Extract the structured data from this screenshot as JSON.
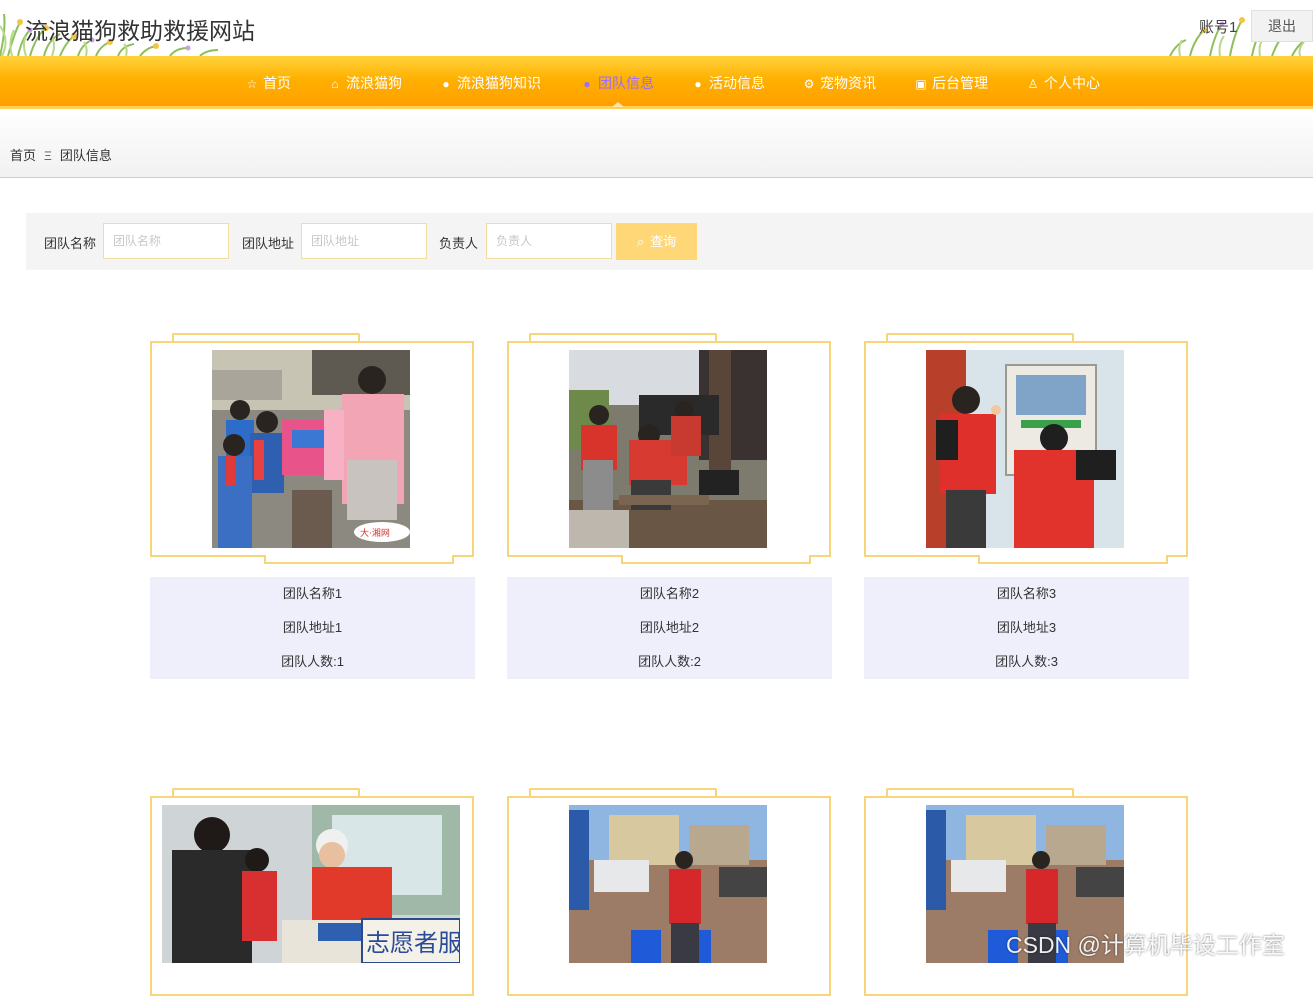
{
  "header": {
    "site_title": "流浪猫狗救助救援网站",
    "account_label": "账号1",
    "logout_label": "退出"
  },
  "nav": {
    "items": [
      {
        "icon": "star-icon",
        "label": "首页"
      },
      {
        "icon": "bag-icon",
        "label": "流浪猫狗"
      },
      {
        "icon": "info-icon",
        "label": "流浪猫狗知识"
      },
      {
        "icon": "help-icon",
        "label": "团队信息",
        "active": true
      },
      {
        "icon": "info-icon",
        "label": "活动信息"
      },
      {
        "icon": "settings-icon",
        "label": "宠物资讯"
      },
      {
        "icon": "gift-icon",
        "label": "后台管理"
      },
      {
        "icon": "user-icon",
        "label": "个人中心"
      }
    ],
    "active_color": "#9c6bff",
    "bar_color": "#ffb000"
  },
  "breadcrumb": {
    "home": "首页",
    "separator": "Ξ",
    "current": "团队信息"
  },
  "search": {
    "name_label": "团队名称",
    "name_placeholder": "团队名称",
    "address_label": "团队地址",
    "address_placeholder": "团队地址",
    "leader_label": "负责人",
    "leader_placeholder": "负责人",
    "button_label": "查询"
  },
  "cards": [
    {
      "name": "团队名称1",
      "address": "团队地址1",
      "count": "团队人数:1",
      "photo": "children-receiving-gifts-photo"
    },
    {
      "name": "团队名称2",
      "address": "团队地址2",
      "count": "团队人数:2",
      "photo": "volunteers-cleaning-bench-photo"
    },
    {
      "name": "团队名称3",
      "address": "团队地址3",
      "count": "团队人数:3",
      "photo": "volunteers-checking-meter-photo"
    },
    {
      "photo": "volunteer-registration-desk-photo",
      "banner_text": "志愿者服务"
    },
    {
      "photo": "volunteer-carrying-water-photo"
    },
    {
      "photo": "volunteer-carrying-water-photo"
    }
  ],
  "watermark": "CSDN @计算机毕设工作室",
  "colors": {
    "accent": "#f8d57a",
    "search_button": "#ffd777",
    "info_panel": "#efeffc"
  }
}
